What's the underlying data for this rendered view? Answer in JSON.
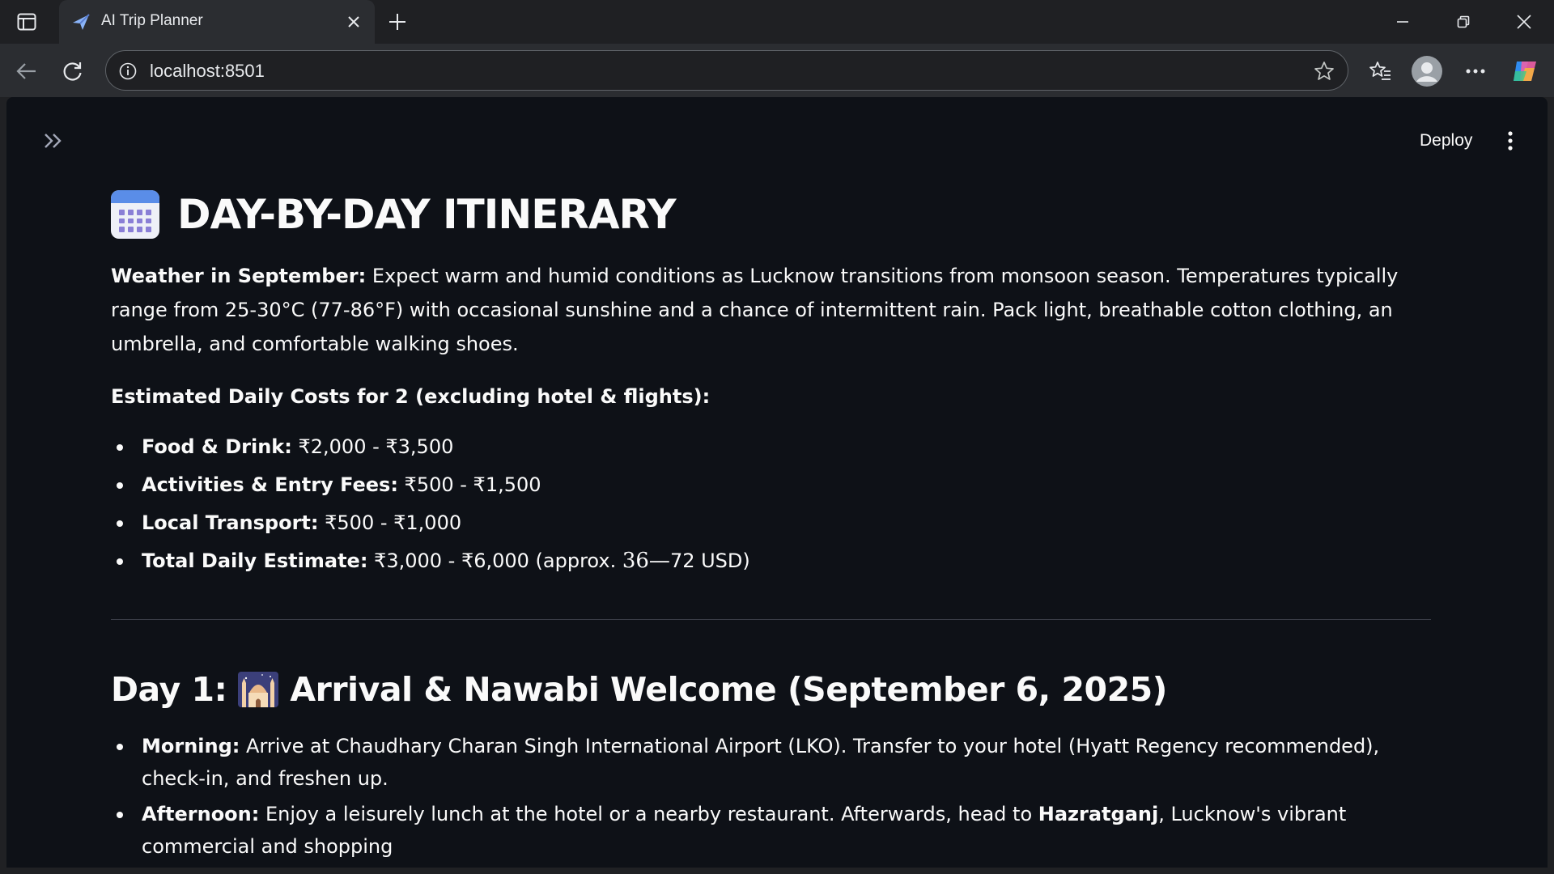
{
  "browser": {
    "tab_title": "AI Trip Planner",
    "url": "localhost:8501"
  },
  "app": {
    "deploy_label": "Deploy"
  },
  "itinerary": {
    "title": "DAY-BY-DAY ITINERARY",
    "weather_label": "Weather in September:",
    "weather_text": " Expect warm and humid conditions as Lucknow transitions from monsoon season. Temperatures typically range from 25-30°C (77-86°F) with occasional sunshine and a chance of intermittent rain. Pack light, breathable cotton clothing, an umbrella, and comfortable walking shoes.",
    "costs_heading": "Estimated Daily Costs for 2 (excluding hotel & flights):",
    "costs": [
      {
        "label": "Food & Drink:",
        "value": " ₹2,000 - ₹3,500"
      },
      {
        "label": "Activities & Entry Fees:",
        "value": " ₹500 - ₹1,500"
      },
      {
        "label": "Local Transport:",
        "value": " ₹500 - ₹1,000"
      },
      {
        "label": "Total Daily Estimate:",
        "value": " ₹3,000 - ₹6,000 (approx. ",
        "math": "36—",
        "tail": "72 USD)"
      }
    ],
    "day1": {
      "prefix": "Day 1:",
      "heading": "Arrival & Nawabi Welcome (September 6, 2025)",
      "items": [
        {
          "label": "Morning:",
          "text": " Arrive at Chaudhary Charan Singh International Airport (LKO). Transfer to your hotel (Hyatt Regency recommended), check-in, and freshen up."
        },
        {
          "label": "Afternoon:",
          "text": " Enjoy a leisurely lunch at the hotel or a nearby restaurant. Afterwards, head to ",
          "bold": "Hazratganj",
          "tail": ", Lucknow's vibrant commercial and shopping"
        }
      ]
    }
  }
}
